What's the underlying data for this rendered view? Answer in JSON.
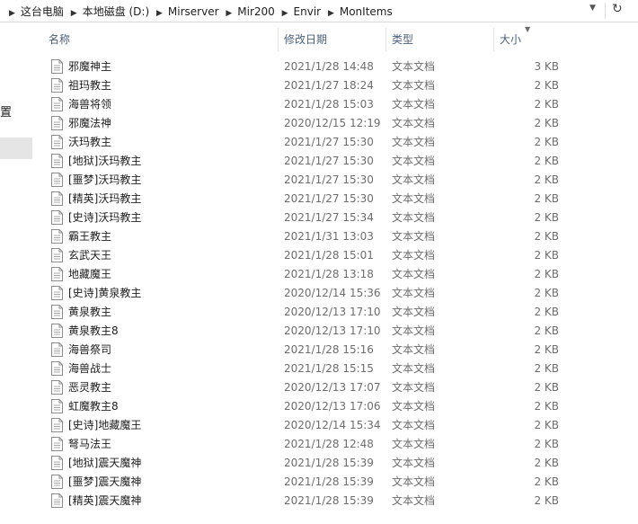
{
  "address_bar": {
    "crumbs": [
      "这台电脑",
      "本地磁盘 (D:)",
      "Mirserver",
      "Mir200",
      "Envir",
      "MonItems"
    ]
  },
  "nav": {
    "partial_label": "置"
  },
  "columns": {
    "name": "名称",
    "date": "修改日期",
    "type": "类型",
    "size": "大小"
  },
  "files": [
    {
      "name": "邪魔神主",
      "date": "2021/1/28 14:48",
      "type": "文本文档",
      "size": "3 KB"
    },
    {
      "name": "祖玛教主",
      "date": "2021/1/27 18:24",
      "type": "文本文档",
      "size": "2 KB"
    },
    {
      "name": "海兽将领",
      "date": "2021/1/28 15:03",
      "type": "文本文档",
      "size": "2 KB"
    },
    {
      "name": "邪魔法神",
      "date": "2020/12/15 12:19",
      "type": "文本文档",
      "size": "2 KB"
    },
    {
      "name": "沃玛教主",
      "date": "2021/1/27 15:30",
      "type": "文本文档",
      "size": "2 KB"
    },
    {
      "name": "[地狱]沃玛教主",
      "date": "2021/1/27 15:30",
      "type": "文本文档",
      "size": "2 KB"
    },
    {
      "name": "[噩梦]沃玛教主",
      "date": "2021/1/27 15:30",
      "type": "文本文档",
      "size": "2 KB"
    },
    {
      "name": "[精英]沃玛教主",
      "date": "2021/1/27 15:30",
      "type": "文本文档",
      "size": "2 KB"
    },
    {
      "name": "[史诗]沃玛教主",
      "date": "2021/1/27 15:34",
      "type": "文本文档",
      "size": "2 KB"
    },
    {
      "name": "霸王教主",
      "date": "2021/1/31 13:03",
      "type": "文本文档",
      "size": "2 KB"
    },
    {
      "name": "玄武天王",
      "date": "2021/1/28 15:01",
      "type": "文本文档",
      "size": "2 KB"
    },
    {
      "name": "地藏魔王",
      "date": "2021/1/28 13:18",
      "type": "文本文档",
      "size": "2 KB"
    },
    {
      "name": "[史诗]黄泉教主",
      "date": "2020/12/14 15:36",
      "type": "文本文档",
      "size": "2 KB"
    },
    {
      "name": "黄泉教主",
      "date": "2020/12/13 17:10",
      "type": "文本文档",
      "size": "2 KB"
    },
    {
      "name": "黄泉教主8",
      "date": "2020/12/13 17:10",
      "type": "文本文档",
      "size": "2 KB"
    },
    {
      "name": "海兽祭司",
      "date": "2021/1/28 15:16",
      "type": "文本文档",
      "size": "2 KB"
    },
    {
      "name": "海兽战士",
      "date": "2021/1/28 15:15",
      "type": "文本文档",
      "size": "2 KB"
    },
    {
      "name": "恶灵教主",
      "date": "2020/12/13 17:07",
      "type": "文本文档",
      "size": "2 KB"
    },
    {
      "name": "虹魔教主8",
      "date": "2020/12/13 17:06",
      "type": "文本文档",
      "size": "2 KB"
    },
    {
      "name": "[史诗]地藏魔王",
      "date": "2020/12/14 15:34",
      "type": "文本文档",
      "size": "2 KB"
    },
    {
      "name": "弩马法王",
      "date": "2021/1/28 12:48",
      "type": "文本文档",
      "size": "2 KB"
    },
    {
      "name": "[地狱]震天魔神",
      "date": "2021/1/28 15:39",
      "type": "文本文档",
      "size": "2 KB"
    },
    {
      "name": "[噩梦]震天魔神",
      "date": "2021/1/28 15:39",
      "type": "文本文档",
      "size": "2 KB"
    },
    {
      "name": "[精英]震天魔神",
      "date": "2021/1/28 15:39",
      "type": "文本文档",
      "size": "2 KB"
    }
  ]
}
